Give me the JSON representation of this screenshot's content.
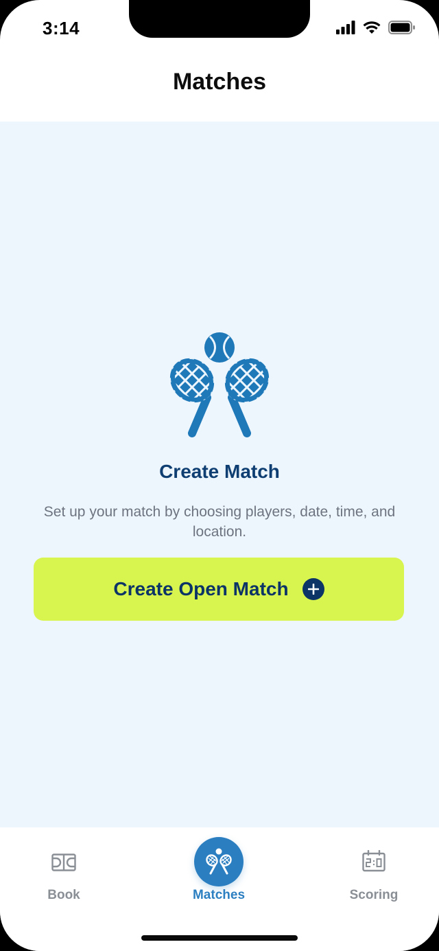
{
  "status_bar": {
    "time": "3:14",
    "icons": [
      "cellular-signal-icon",
      "wifi-icon",
      "battery-icon"
    ]
  },
  "header": {
    "title": "Matches"
  },
  "empty_state": {
    "icon": "crossed-tennis-rackets-ball-icon",
    "title": "Create Match",
    "description": "Set up your match by choosing players, date, time, and location."
  },
  "cta": {
    "label": "Create Open Match",
    "icon": "plus-circle-icon"
  },
  "tab_bar": {
    "items": [
      {
        "label": "Book",
        "icon": "court-icon",
        "active": false
      },
      {
        "label": "Matches",
        "icon": "tennis-rackets-icon",
        "active": true
      },
      {
        "label": "Scoring",
        "icon": "scoreboard-icon",
        "active": false
      }
    ]
  },
  "colors": {
    "primary_navy": "#0c3466",
    "accent_blue": "#2b7ec0",
    "cta_lime": "#d8f44f",
    "content_bg": "#eef6fd",
    "muted_text": "#6d7480"
  }
}
